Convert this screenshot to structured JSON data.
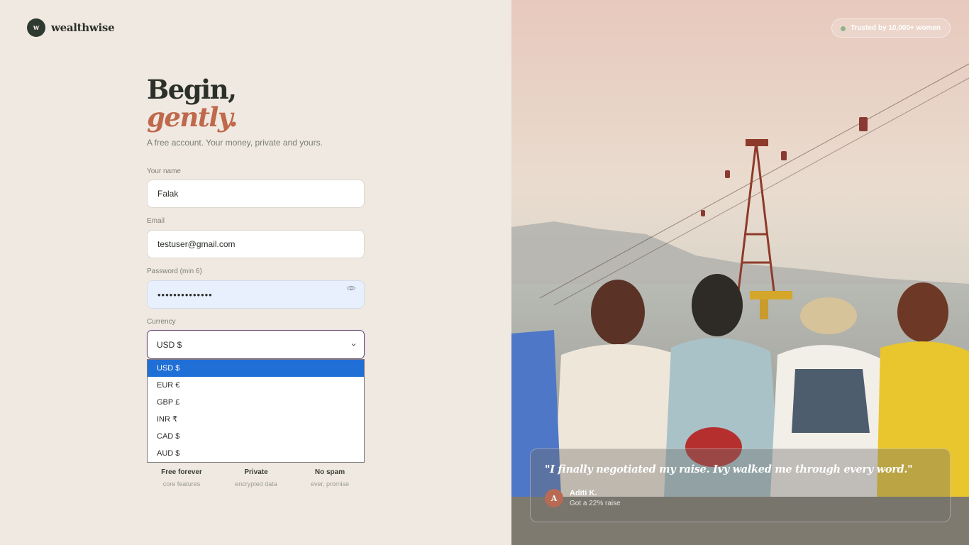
{
  "brand": {
    "logo_letter": "w",
    "name": "wealthwise"
  },
  "hero": {
    "line1": "Begin,",
    "line2": "gently.",
    "subtitle": "A free account. Your money, private and yours."
  },
  "form": {
    "name_label": "Your name",
    "name_value": "Falak",
    "email_label": "Email",
    "email_value": "testuser@gmail.com",
    "password_label": "Password (min 6)",
    "password_value": "••••••••••••••",
    "currency_label": "Currency",
    "currency_value": "USD $",
    "currency_options": [
      "USD $",
      "EUR €",
      "GBP £",
      "INR ₹",
      "CAD $",
      "AUD $"
    ]
  },
  "features": [
    {
      "title": "Free forever",
      "sub": "core features"
    },
    {
      "title": "Private",
      "sub": "encrypted data"
    },
    {
      "title": "No spam",
      "sub": "ever, promise"
    }
  ],
  "badge": {
    "text": "Trusted by 10,000+ women"
  },
  "testimonial": {
    "quote": "\"I finally negotiated my raise. Ivy walked me through every word.\"",
    "avatar_letter": "A",
    "author": "Aditi K.",
    "author_sub": "Got a 22% raise"
  },
  "colors": {
    "background": "#efe9e1",
    "accent": "#c0684c",
    "dark": "#2e3a30",
    "selected_option": "#1f6fd6"
  }
}
